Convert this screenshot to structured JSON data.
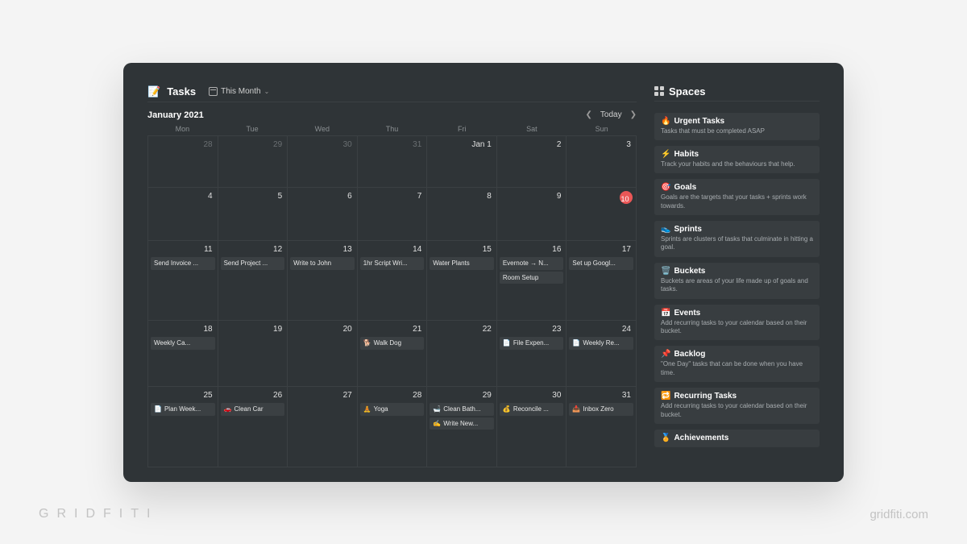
{
  "watermark": {
    "left": "GRIDFITI",
    "right": "gridfiti.com"
  },
  "header": {
    "icon": "📝",
    "title": "Tasks",
    "view_label": "This Month"
  },
  "calendar": {
    "month_label": "January 2021",
    "today_label": "Today",
    "dow": [
      "Mon",
      "Tue",
      "Wed",
      "Thu",
      "Fri",
      "Sat",
      "Sun"
    ],
    "weeks": [
      [
        {
          "d": "28",
          "dim": true,
          "events": []
        },
        {
          "d": "29",
          "dim": true,
          "events": []
        },
        {
          "d": "30",
          "dim": true,
          "events": []
        },
        {
          "d": "31",
          "dim": true,
          "events": []
        },
        {
          "d": "Jan 1",
          "events": []
        },
        {
          "d": "2",
          "events": []
        },
        {
          "d": "3",
          "events": []
        }
      ],
      [
        {
          "d": "4",
          "events": []
        },
        {
          "d": "5",
          "events": []
        },
        {
          "d": "6",
          "events": []
        },
        {
          "d": "7",
          "events": []
        },
        {
          "d": "8",
          "events": []
        },
        {
          "d": "9",
          "events": []
        },
        {
          "d": "10",
          "today": true,
          "events": []
        }
      ],
      [
        {
          "d": "11",
          "events": [
            {
              "t": "Send Invoice ..."
            }
          ]
        },
        {
          "d": "12",
          "events": [
            {
              "t": "Send Project ..."
            }
          ]
        },
        {
          "d": "13",
          "events": [
            {
              "t": "Write to John"
            }
          ]
        },
        {
          "d": "14",
          "events": [
            {
              "t": "1hr Script Wri..."
            }
          ]
        },
        {
          "d": "15",
          "events": [
            {
              "t": "Water Plants"
            }
          ]
        },
        {
          "d": "16",
          "events": [
            {
              "t": "Evernote → N..."
            },
            {
              "t": "Room Setup"
            }
          ]
        },
        {
          "d": "17",
          "events": [
            {
              "t": "Set up Googl..."
            }
          ]
        }
      ],
      [
        {
          "d": "18",
          "events": [
            {
              "t": "Weekly Ca..."
            }
          ]
        },
        {
          "d": "19",
          "events": []
        },
        {
          "d": "20",
          "events": []
        },
        {
          "d": "21",
          "events": [
            {
              "i": "🐕",
              "t": "Walk Dog"
            }
          ]
        },
        {
          "d": "22",
          "events": []
        },
        {
          "d": "23",
          "events": [
            {
              "i": "📄",
              "t": "File Expen..."
            }
          ]
        },
        {
          "d": "24",
          "events": [
            {
              "i": "📄",
              "t": "Weekly Re..."
            }
          ]
        }
      ],
      [
        {
          "d": "25",
          "events": [
            {
              "i": "📄",
              "t": "Plan Week..."
            }
          ]
        },
        {
          "d": "26",
          "events": [
            {
              "i": "🚗",
              "t": "Clean Car"
            }
          ]
        },
        {
          "d": "27",
          "events": []
        },
        {
          "d": "28",
          "events": [
            {
              "i": "🧘",
              "t": "Yoga"
            }
          ]
        },
        {
          "d": "29",
          "events": [
            {
              "i": "🛁",
              "t": "Clean Bath..."
            },
            {
              "i": "✍️",
              "t": "Write New..."
            }
          ]
        },
        {
          "d": "30",
          "events": [
            {
              "i": "💰",
              "t": "Reconcile ..."
            }
          ]
        },
        {
          "d": "31",
          "events": [
            {
              "i": "📥",
              "t": "Inbox Zero"
            }
          ]
        }
      ]
    ]
  },
  "spaces": {
    "title": "Spaces",
    "items": [
      {
        "icon": "🔥",
        "title": "Urgent Tasks",
        "desc": "Tasks that must be completed ASAP"
      },
      {
        "icon": "⚡",
        "title": "Habits",
        "desc": "Track your habits and the behaviours that help."
      },
      {
        "icon": "🎯",
        "title": "Goals",
        "desc": "Goals are the targets that your tasks + sprints work towards."
      },
      {
        "icon": "👟",
        "title": "Sprints",
        "desc": "Sprints are clusters of tasks that culminate in hitting a goal."
      },
      {
        "icon": "🗑️",
        "title": "Buckets",
        "desc": "Buckets are areas of your life made up of goals and tasks."
      },
      {
        "icon": "📅",
        "title": "Events",
        "desc": "Add recurring tasks to your calendar based on their bucket."
      },
      {
        "icon": "📌",
        "title": "Backlog",
        "desc": "\"One Day\" tasks that can be done when you have time."
      },
      {
        "icon": "🔁",
        "title": "Recurring Tasks",
        "desc": "Add recurring tasks to your calendar based on their bucket."
      },
      {
        "icon": "🏅",
        "title": "Achievements",
        "desc": ""
      }
    ]
  }
}
